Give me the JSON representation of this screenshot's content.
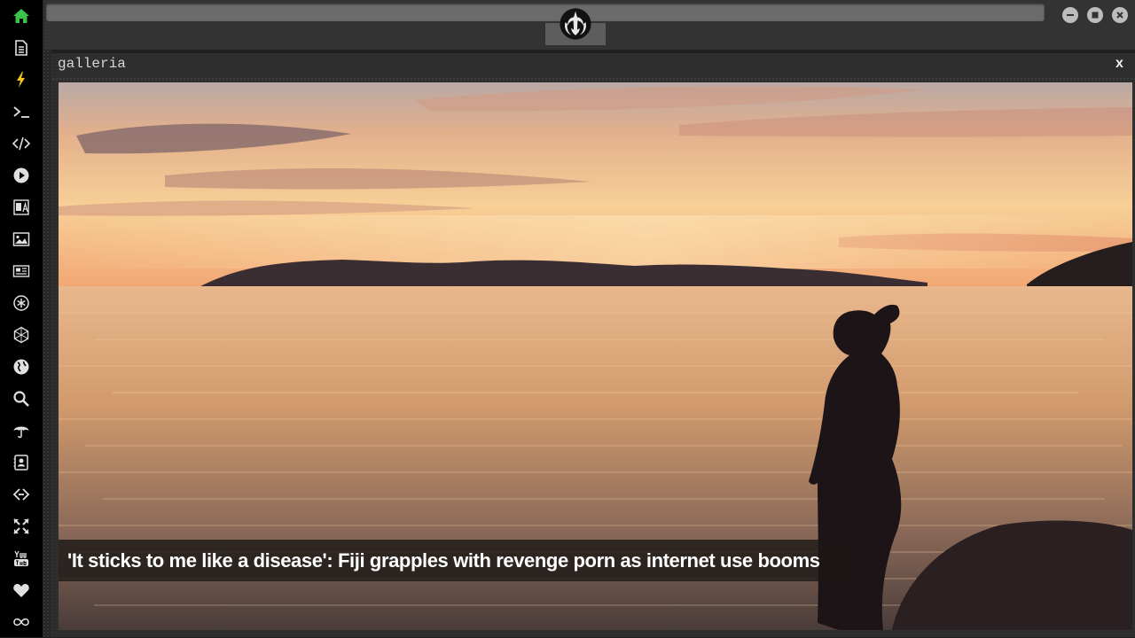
{
  "sidebar": {
    "items": [
      {
        "name": "home-icon",
        "color": "#3cc24a"
      },
      {
        "name": "document-icon"
      },
      {
        "name": "lightning-icon",
        "color": "#f2c618"
      },
      {
        "name": "terminal-icon"
      },
      {
        "name": "code-icon"
      },
      {
        "name": "play-icon"
      },
      {
        "name": "translate-icon"
      },
      {
        "name": "image-icon"
      },
      {
        "name": "newspaper-icon"
      },
      {
        "name": "asterisk-icon"
      },
      {
        "name": "hexagon-icon"
      },
      {
        "name": "globe-icon"
      },
      {
        "name": "search-icon"
      },
      {
        "name": "umbrella-icon"
      },
      {
        "name": "contact-icon"
      },
      {
        "name": "link-icon"
      },
      {
        "name": "expand-icon"
      },
      {
        "name": "youtube-icon"
      },
      {
        "name": "heart-icon"
      },
      {
        "name": "infinity-icon"
      }
    ]
  },
  "window": {
    "logo": "rebel-alliance-icon",
    "controls": [
      "minimize-icon",
      "maximize-icon",
      "close-icon"
    ]
  },
  "panel": {
    "title": "galleria",
    "close_label": "x"
  },
  "gallery": {
    "caption": "'It sticks to me like a disease': Fiji grapples with revenge porn as internet use booms"
  },
  "colors": {
    "sidebar_bg": "#000000",
    "topbar_bg": "#333333",
    "panel_bg": "#2e2e2e",
    "home_accent": "#3cc24a",
    "lightning_accent": "#f2c618"
  }
}
